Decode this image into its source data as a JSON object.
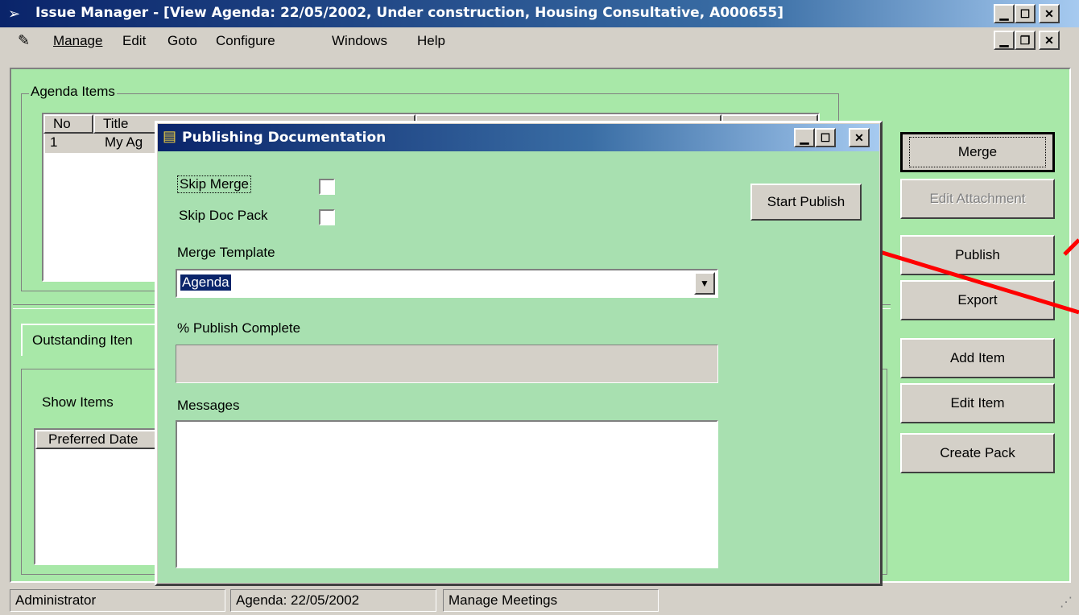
{
  "window": {
    "title": "Issue Manager - [View Agenda: 22/05/2002, Under construction, Housing Consultative, A000655]",
    "controls": {
      "minimize": "_",
      "maximize": "□",
      "close": "×",
      "restore": "▫"
    }
  },
  "menu": {
    "items": [
      {
        "label": "Manage"
      },
      {
        "label": "Edit"
      },
      {
        "label": "Goto"
      },
      {
        "label": "Configure"
      },
      {
        "label": "Windows"
      },
      {
        "label": "Help"
      }
    ]
  },
  "agenda_items": {
    "group_label": "Agenda Items",
    "columns": [
      "No",
      "Title"
    ],
    "rows": [
      {
        "no": "1",
        "title": "My Ag"
      }
    ]
  },
  "outstanding": {
    "tab_label": "Outstanding Iten",
    "show_items_label": "Show Items",
    "column": "Preferred Date"
  },
  "side_buttons": {
    "merge": "Merge",
    "edit_attachment": "Edit Attachment",
    "publish": "Publish",
    "export": "Export",
    "add_item": "Add Item",
    "edit_item": "Edit Item",
    "create_pack": "Create Pack"
  },
  "dialog": {
    "title": "Publishing Documentation",
    "skip_merge_label": "Skip Merge",
    "skip_merge_checked": false,
    "skip_doc_pack_label": "Skip Doc Pack",
    "skip_doc_pack_checked": false,
    "start_publish": "Start Publish",
    "merge_template_label": "Merge Template",
    "merge_template_value": "Agenda",
    "publish_complete_label": "% Publish Complete",
    "publish_progress": 0,
    "messages_label": "Messages",
    "messages_value": ""
  },
  "status_bar": {
    "user": "Administrator",
    "agenda": "Agenda: 22/05/2002",
    "section": "Manage Meetings"
  },
  "colors": {
    "title_active": "#0a246a",
    "main_background": "#a8e8a8",
    "dialog_background": "#a8e0b0",
    "annotation_arrow": "#ff0000"
  }
}
